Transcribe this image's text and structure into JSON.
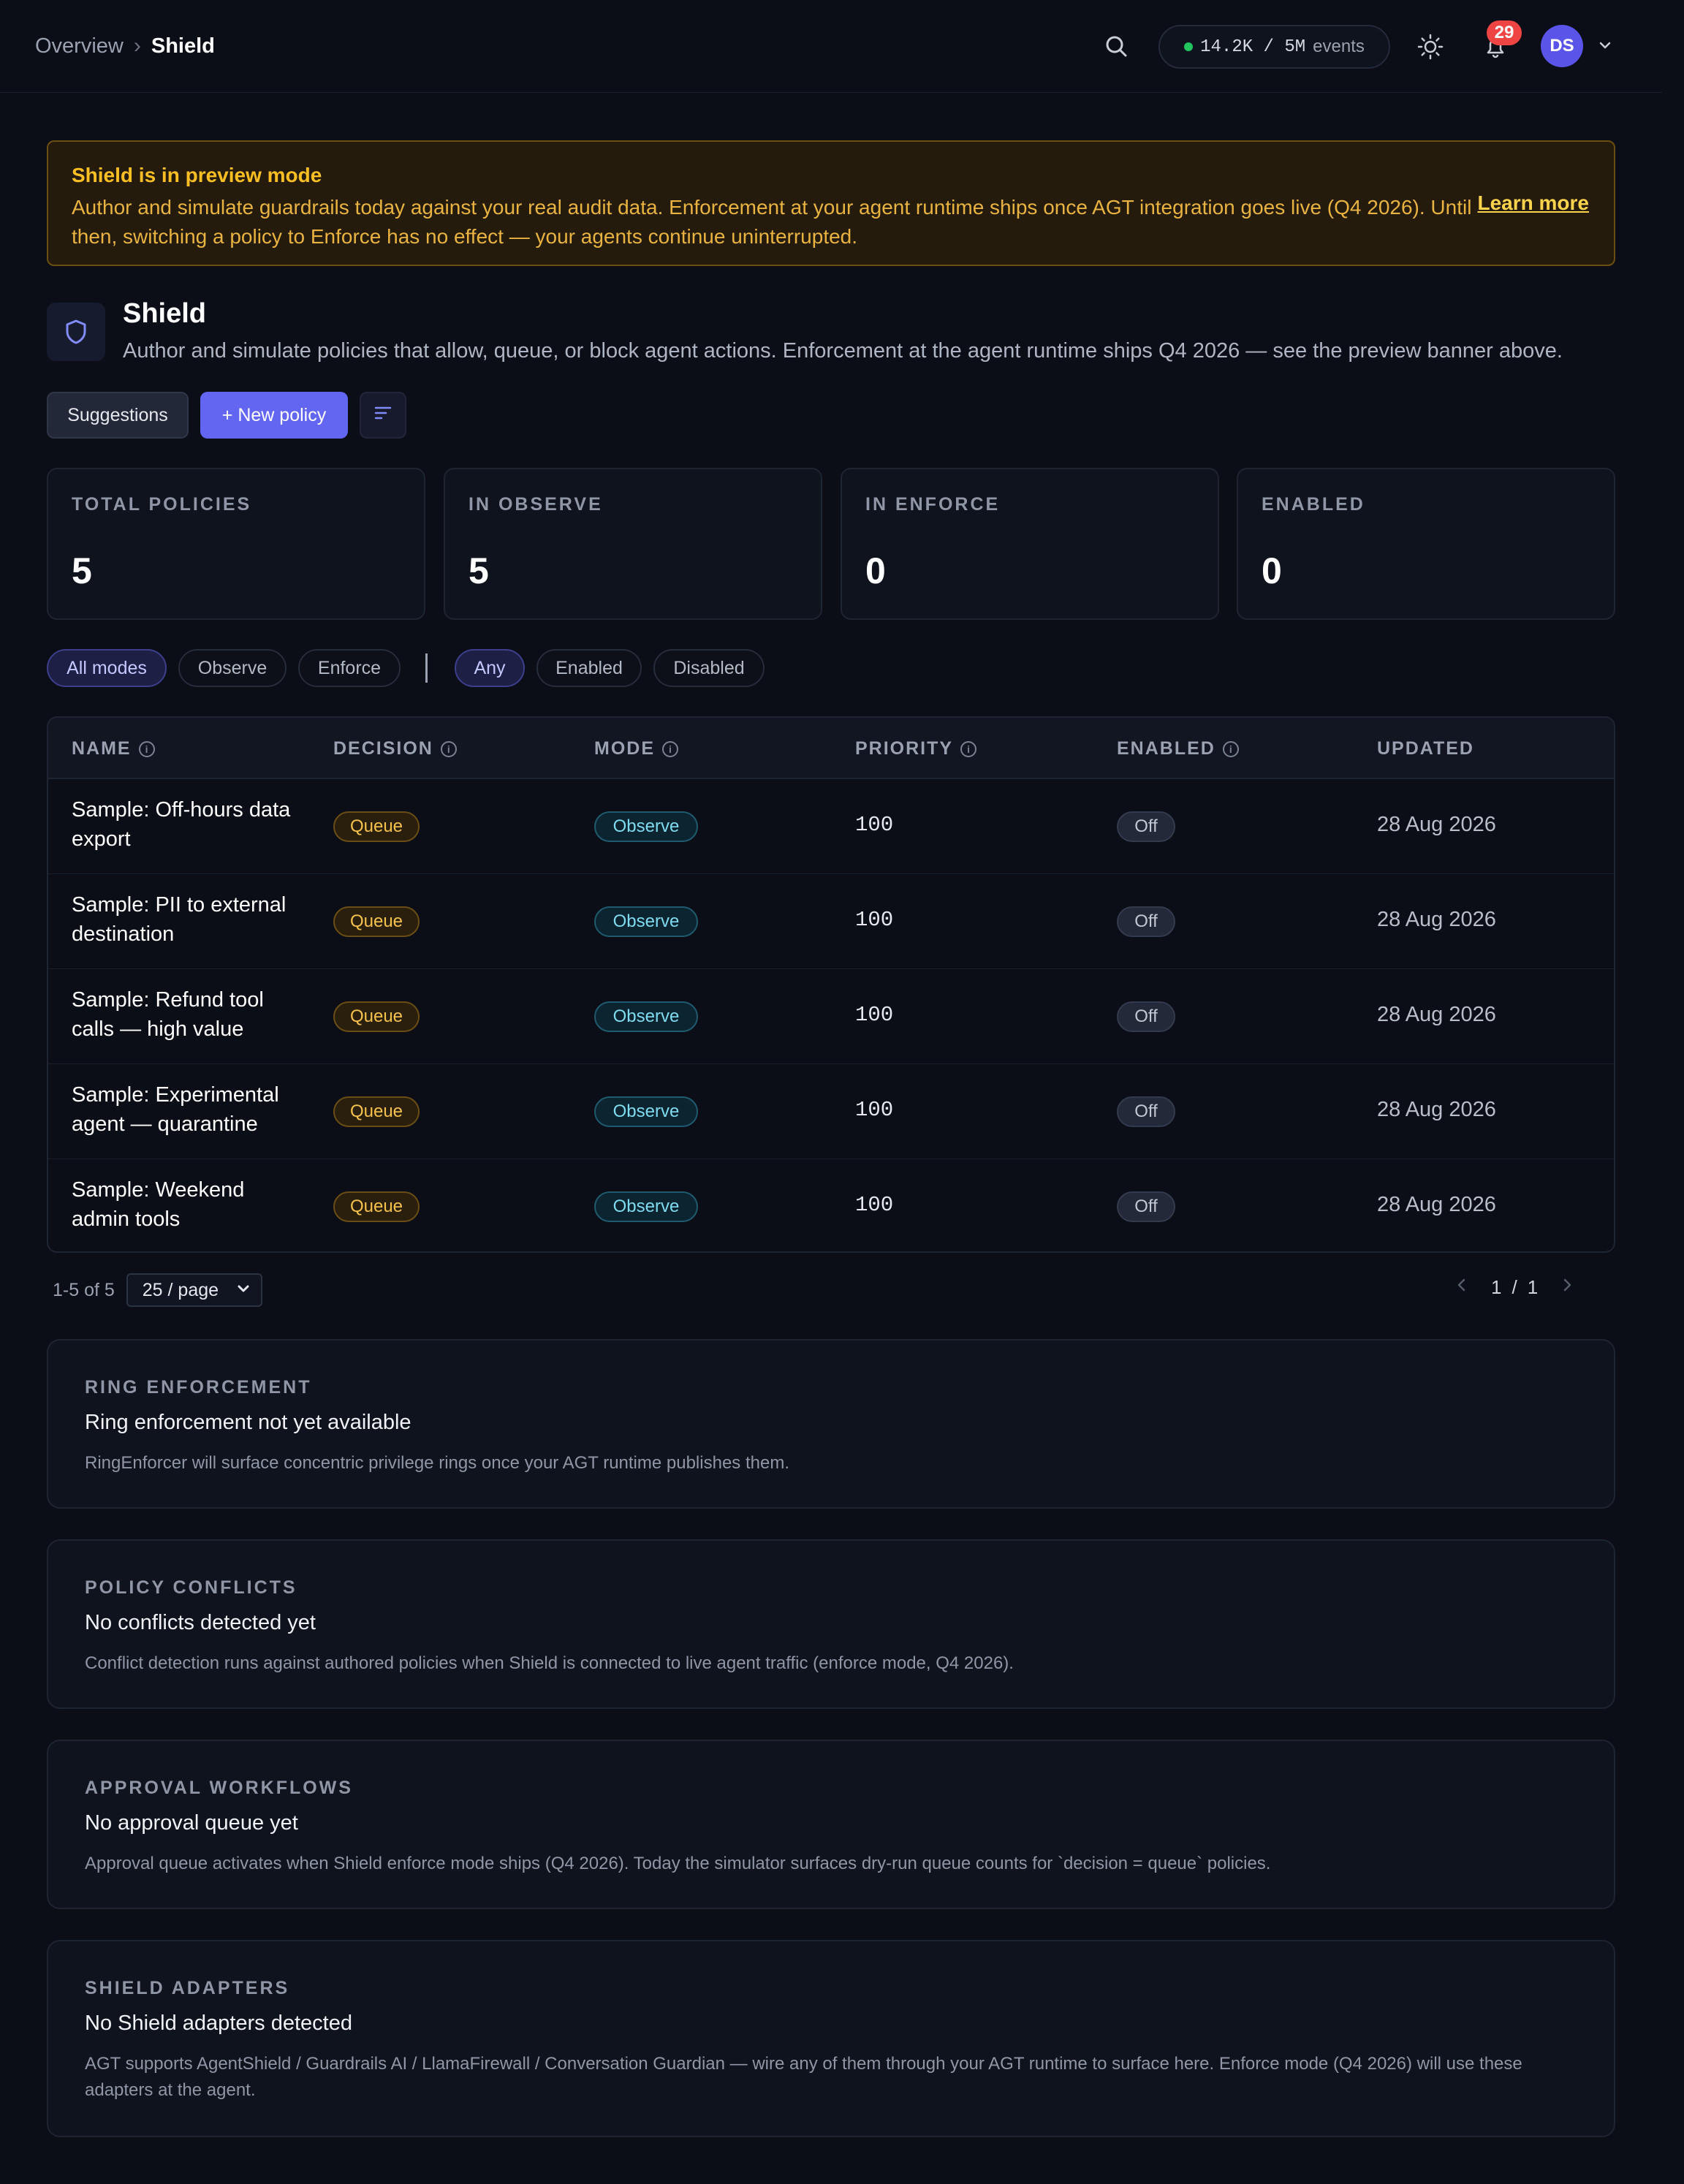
{
  "header": {
    "breadcrumb": [
      "Overview",
      "Shield"
    ],
    "events_value": "14.2K / 5M",
    "events_unit": "events",
    "notifications_count": "29",
    "avatar_initials": "DS"
  },
  "banner": {
    "title": "Shield is in preview mode",
    "body": "Author and simulate guardrails today against your real audit data. Enforcement at your agent runtime ships once AGT integration goes live (Q4 2026). Until then, switching a policy to Enforce has no effect — your agents continue uninterrupted.",
    "link": "Learn more"
  },
  "page": {
    "title": "Shield",
    "subtitle": "Author and simulate policies that allow, queue, or block agent actions. Enforcement at the agent runtime ships Q4 2026 — see the preview banner above.",
    "buttons": {
      "suggestions": "Suggestions",
      "new_policy": "+ New policy"
    }
  },
  "stats": [
    {
      "label": "TOTAL POLICIES",
      "value": "5"
    },
    {
      "label": "IN OBSERVE",
      "value": "5"
    },
    {
      "label": "IN ENFORCE",
      "value": "0"
    },
    {
      "label": "ENABLED",
      "value": "0"
    }
  ],
  "filters": {
    "modes": [
      "All modes",
      "Observe",
      "Enforce"
    ],
    "status": [
      "Any",
      "Enabled",
      "Disabled"
    ]
  },
  "table": {
    "columns": [
      "NAME",
      "DECISION",
      "MODE",
      "PRIORITY",
      "ENABLED",
      "UPDATED"
    ],
    "rows": [
      {
        "name": "Sample: Off-hours data export",
        "decision": "Queue",
        "mode": "Observe",
        "priority": "100",
        "enabled": "Off",
        "updated": "28 Aug 2026"
      },
      {
        "name": "Sample: PII to external destination",
        "decision": "Queue",
        "mode": "Observe",
        "priority": "100",
        "enabled": "Off",
        "updated": "28 Aug 2026"
      },
      {
        "name": "Sample: Refund tool calls — high value",
        "decision": "Queue",
        "mode": "Observe",
        "priority": "100",
        "enabled": "Off",
        "updated": "28 Aug 2026"
      },
      {
        "name": "Sample: Experimental agent — quarantine",
        "decision": "Queue",
        "mode": "Observe",
        "priority": "100",
        "enabled": "Off",
        "updated": "28 Aug 2026"
      },
      {
        "name": "Sample: Weekend admin tools",
        "decision": "Queue",
        "mode": "Observe",
        "priority": "100",
        "enabled": "Off",
        "updated": "28 Aug 2026"
      }
    ]
  },
  "pagination": {
    "range": "1-5 of 5",
    "per_page": "25 / page",
    "current": "1",
    "sep": "/",
    "total": "1"
  },
  "cards": [
    {
      "title": "RING ENFORCEMENT",
      "heading": "Ring enforcement not yet available",
      "desc": "RingEnforcer will surface concentric privilege rings once your AGT runtime publishes them."
    },
    {
      "title": "POLICY CONFLICTS",
      "heading": "No conflicts detected yet",
      "desc": "Conflict detection runs against authored policies when Shield is connected to live agent traffic (enforce mode, Q4 2026)."
    },
    {
      "title": "APPROVAL WORKFLOWS",
      "heading": "No approval queue yet",
      "desc": "Approval queue activates when Shield enforce mode ships (Q4 2026). Today the simulator surfaces dry-run queue counts for `decision = queue` policies."
    },
    {
      "title": "SHIELD ADAPTERS",
      "heading": "No Shield adapters detected",
      "desc": "AGT supports AgentShield / Guardrails AI / LlamaFirewall / Conversation Guardian — wire any of them through your AGT runtime to surface here. Enforce mode (Q4 2026) will use these adapters at the agent."
    }
  ]
}
